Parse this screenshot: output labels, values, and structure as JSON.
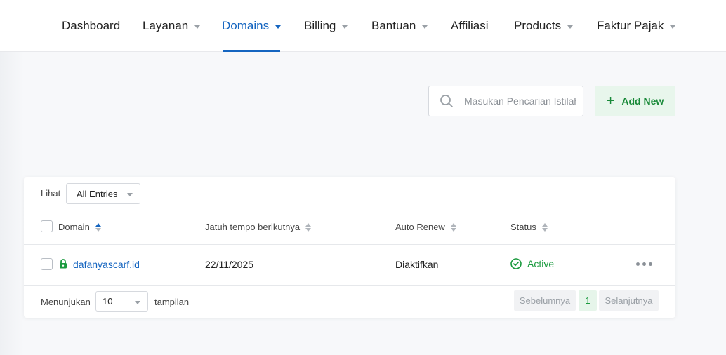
{
  "nav": {
    "items": [
      {
        "label": "Dashboard",
        "has_caret": false,
        "active": false
      },
      {
        "label": "Layanan",
        "has_caret": true,
        "active": false
      },
      {
        "label": "Domains",
        "has_caret": true,
        "active": true
      },
      {
        "label": "Billing",
        "has_caret": true,
        "active": false
      },
      {
        "label": "Bantuan",
        "has_caret": true,
        "active": false
      },
      {
        "label": "Affiliasi",
        "has_caret": false,
        "active": false
      },
      {
        "label": "Products",
        "has_caret": true,
        "active": false
      },
      {
        "label": "Faktur Pajak",
        "has_caret": true,
        "active": false
      }
    ]
  },
  "search": {
    "placeholder": "Masukan Pencarian Istilah",
    "icon": "search-icon"
  },
  "add_button": {
    "label": "Add New",
    "icon": "plus-icon"
  },
  "table": {
    "show_label": "Lihat",
    "entries_value": "All Entries",
    "columns": {
      "domain": "Domain",
      "due": "Jatuh tempo berikutnya",
      "renew": "Auto Renew",
      "status": "Status"
    },
    "rows": [
      {
        "domain": "dafanyascarf.id",
        "due": "22/11/2025",
        "renew": "Diaktifkan",
        "status": "Active",
        "lock_icon": "lock-icon",
        "status_icon": "check-circle-icon"
      }
    ]
  },
  "footer": {
    "showing_label": "Menunjukan",
    "per_page": "10",
    "suffix_label": "tampilan",
    "prev": "Sebelumnya",
    "page": "1",
    "next": "Selanjutnya"
  },
  "colors": {
    "accent": "#1565c0",
    "success": "#1a9a3e",
    "add_bg": "#e8f6ec"
  }
}
